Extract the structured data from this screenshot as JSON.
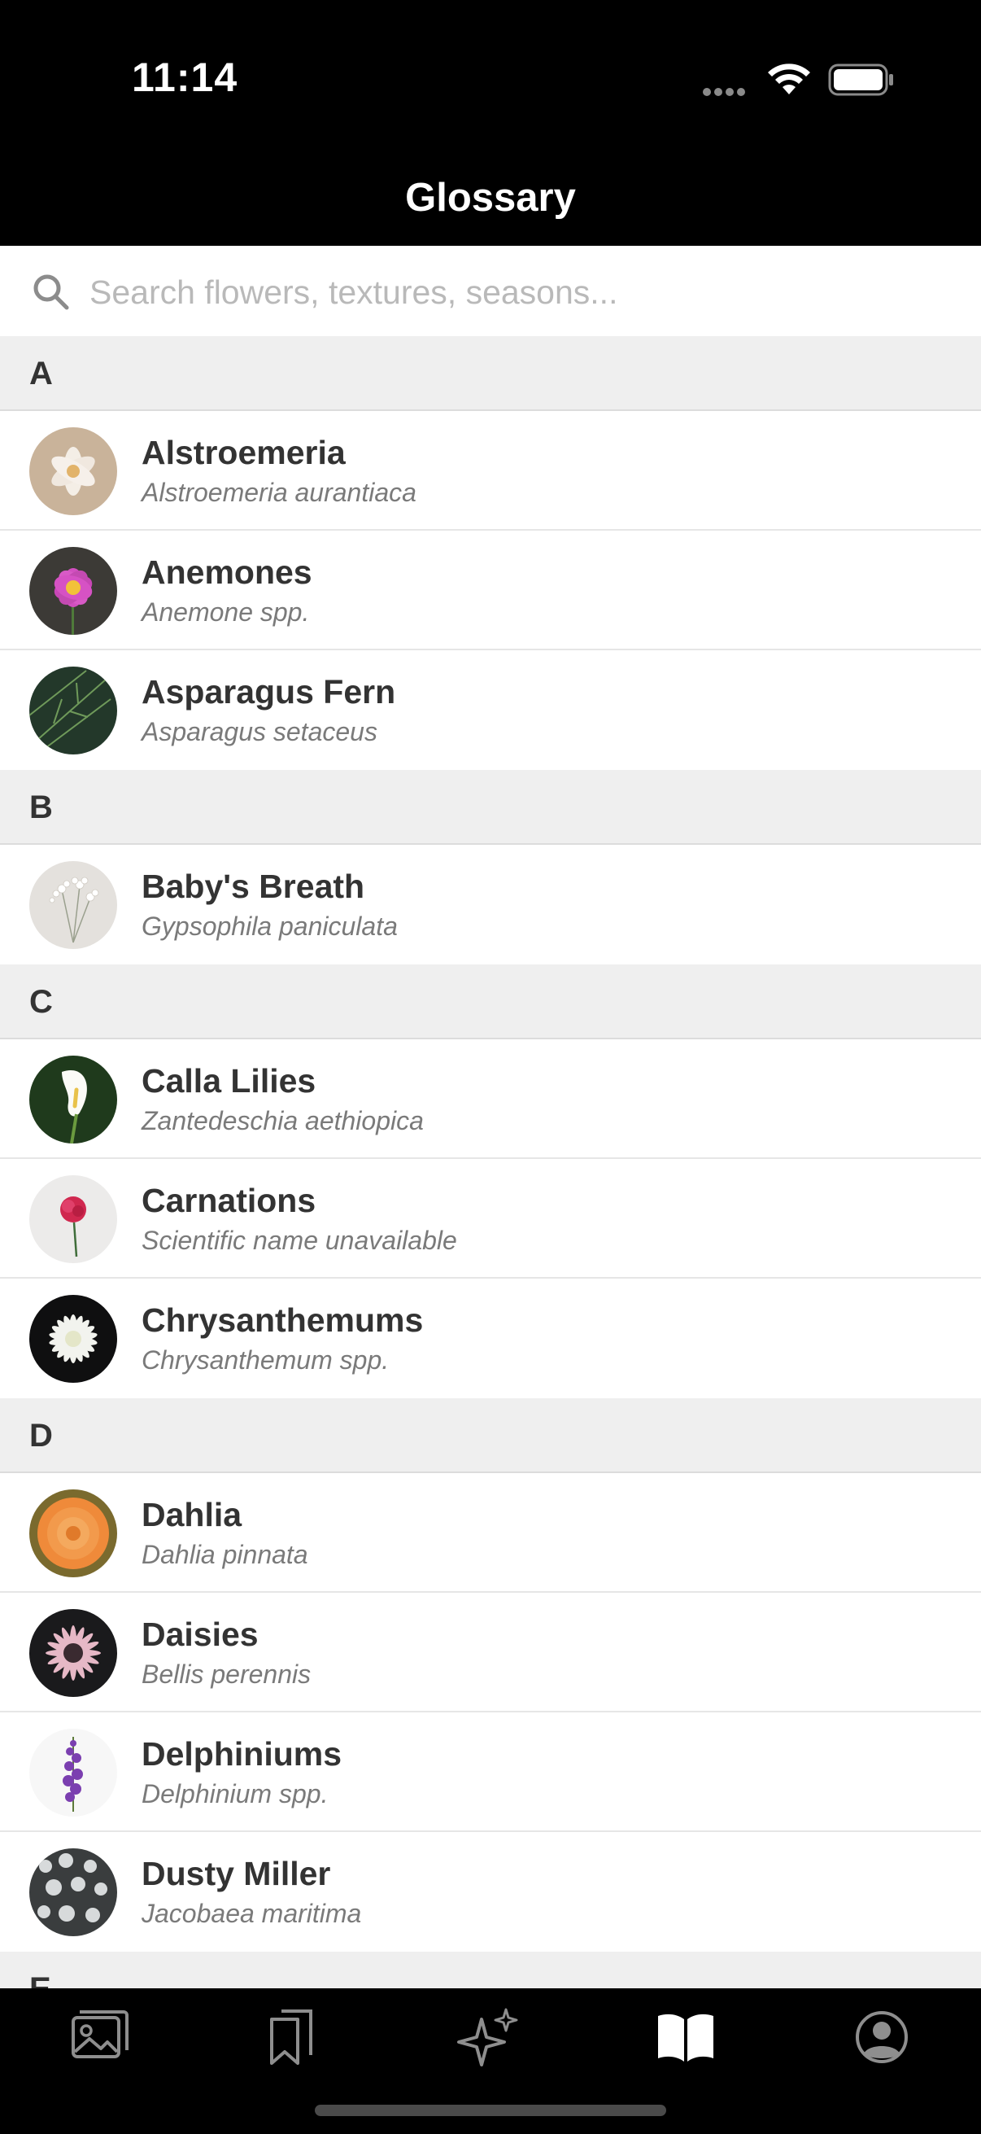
{
  "status_bar": {
    "time": "11:14"
  },
  "header": {
    "title": "Glossary"
  },
  "search": {
    "placeholder": "Search flowers, textures, seasons..."
  },
  "sections": [
    {
      "letter": "A",
      "items": [
        {
          "name": "Alstroemeria",
          "scientific": "Alstroemeria aurantiaca"
        },
        {
          "name": "Anemones",
          "scientific": "Anemone spp."
        },
        {
          "name": "Asparagus Fern",
          "scientific": "Asparagus setaceus"
        }
      ]
    },
    {
      "letter": "B",
      "items": [
        {
          "name": "Baby's Breath",
          "scientific": "Gypsophila paniculata"
        }
      ]
    },
    {
      "letter": "C",
      "items": [
        {
          "name": "Calla Lilies",
          "scientific": "Zantedeschia aethiopica"
        },
        {
          "name": "Carnations",
          "scientific": "Scientific name unavailable"
        },
        {
          "name": "Chrysanthemums",
          "scientific": "Chrysanthemum spp."
        }
      ]
    },
    {
      "letter": "D",
      "items": [
        {
          "name": "Dahlia",
          "scientific": "Dahlia pinnata"
        },
        {
          "name": "Daisies",
          "scientific": "Bellis perennis"
        },
        {
          "name": "Delphiniums",
          "scientific": "Delphinium spp."
        },
        {
          "name": "Dusty Miller",
          "scientific": "Jacobaea maritima"
        }
      ]
    },
    {
      "letter": "E",
      "items": []
    }
  ],
  "tab_bar": {
    "tabs": [
      {
        "icon": "photo-gallery-icon",
        "active": false
      },
      {
        "icon": "bookmarks-icon",
        "active": false
      },
      {
        "icon": "sparkles-icon",
        "active": false
      },
      {
        "icon": "open-book-icon",
        "active": true
      },
      {
        "icon": "profile-icon",
        "active": false
      }
    ]
  },
  "colors": {
    "header_bg": "#000000",
    "section_bg": "#efefef",
    "placeholder": "#b9b9b9",
    "tab_active": "#ffffff",
    "tab_inactive": "#8e8e8e"
  }
}
